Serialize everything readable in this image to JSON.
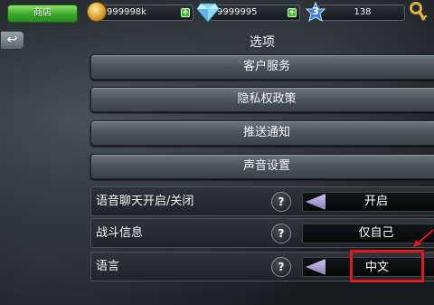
{
  "topbar": {
    "shop_label": "商店",
    "gold": "999998k",
    "gems": "9999995",
    "level": "3",
    "xp": "138"
  },
  "header": {
    "title": "选项",
    "back_icon": "back-arrow-icon"
  },
  "menu": {
    "customer_service": "客户服务",
    "privacy_policy": "隐私权政策",
    "push_notifications": "推送通知",
    "sound_settings": "声音设置"
  },
  "settings": [
    {
      "label": "语音聊天开启/关闭",
      "help": "?",
      "value": "开启"
    },
    {
      "label": "战斗信息",
      "help": "?",
      "value": "仅自己"
    },
    {
      "label": "语言",
      "help": "?",
      "value": "中文"
    }
  ],
  "colors": {
    "shop_green": "#3aa82a",
    "highlight_red": "#e01818",
    "arrow_purple": "#8a7bb6"
  }
}
